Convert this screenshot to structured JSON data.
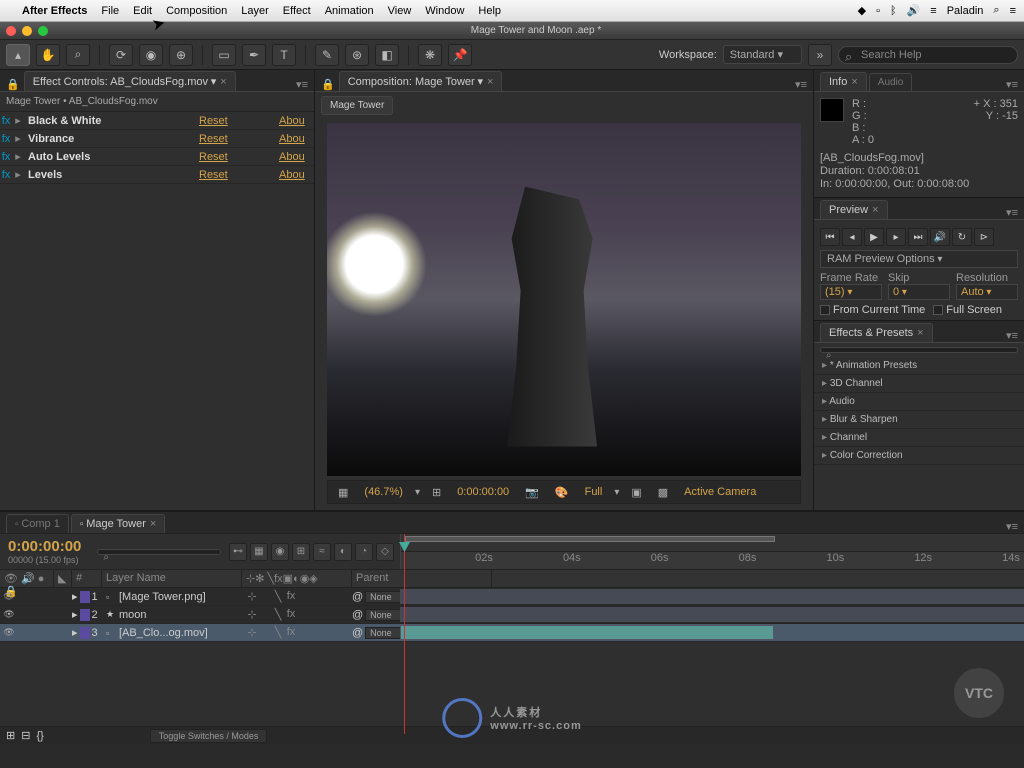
{
  "menubar": {
    "apple": "",
    "app": "After Effects",
    "items": [
      "File",
      "Edit",
      "Composition",
      "Layer",
      "Effect",
      "Animation",
      "View",
      "Window",
      "Help"
    ],
    "user": "Paladin"
  },
  "window": {
    "title": "Mage Tower and Moon .aep *"
  },
  "toolbar": {
    "workspace_label": "Workspace:",
    "workspace_value": "Standard",
    "search_placeholder": "Search Help"
  },
  "effect_controls": {
    "tab": "Effect Controls: AB_CloudsFog.mov",
    "breadcrumb": "Mage Tower • AB_CloudsFog.mov",
    "reset_label": "Reset",
    "about_label": "Abou",
    "effects": [
      {
        "name": "Black & White"
      },
      {
        "name": "Vibrance"
      },
      {
        "name": "Auto Levels"
      },
      {
        "name": "Levels"
      }
    ]
  },
  "composition": {
    "tab": "Composition: Mage Tower",
    "subtab": "Mage Tower",
    "zoom": "(46.7%)",
    "time": "0:00:00:00",
    "resolution": "Full",
    "camera": "Active Camera"
  },
  "info": {
    "tab1": "Info",
    "tab2": "Audio",
    "r": "R :",
    "g": "G :",
    "b": "B :",
    "a": "A :  0",
    "x": "X : 351",
    "y": "Y : -15",
    "footage_name": "[AB_CloudsFog.mov]",
    "duration": "Duration: 0:00:08:01",
    "inout": "In: 0:00:00:00, Out: 0:00:08:00"
  },
  "preview": {
    "tab": "Preview",
    "ram_label": "RAM Preview Options",
    "frame_rate_label": "Frame Rate",
    "frame_rate_value": "(15)",
    "skip_label": "Skip",
    "skip_value": "0",
    "resolution_label": "Resolution",
    "resolution_value": "Auto",
    "from_current": "From Current Time",
    "full_screen": "Full Screen"
  },
  "effects_presets": {
    "tab": "Effects & Presets",
    "search_placeholder": "",
    "items": [
      "* Animation Presets",
      "3D Channel",
      "Audio",
      "Blur & Sharpen",
      "Channel",
      "Color Correction"
    ]
  },
  "timeline": {
    "tab1": "Comp 1",
    "tab2": "Mage Tower",
    "timecode": "0:00:00:00",
    "fps": "00000 (15.00 fps)",
    "search_placeholder": "",
    "col_layer": "Layer Name",
    "col_parent": "Parent",
    "parent_none": "None",
    "ruler_marks": [
      "",
      "02s",
      "04s",
      "06s",
      "08s",
      "10s",
      "12s",
      "14s"
    ],
    "layers": [
      {
        "idx": "1",
        "name": "[Mage Tower.png]",
        "icon": "▫"
      },
      {
        "idx": "2",
        "name": "moon",
        "icon": "★"
      },
      {
        "idx": "3",
        "name": "[AB_Clo...og.mov]",
        "icon": "▫"
      }
    ],
    "toggle_label": "Toggle Switches / Modes"
  },
  "watermark": {
    "text": "人人素材",
    "url": "www.rr-sc.com",
    "vtc": "VTC"
  }
}
